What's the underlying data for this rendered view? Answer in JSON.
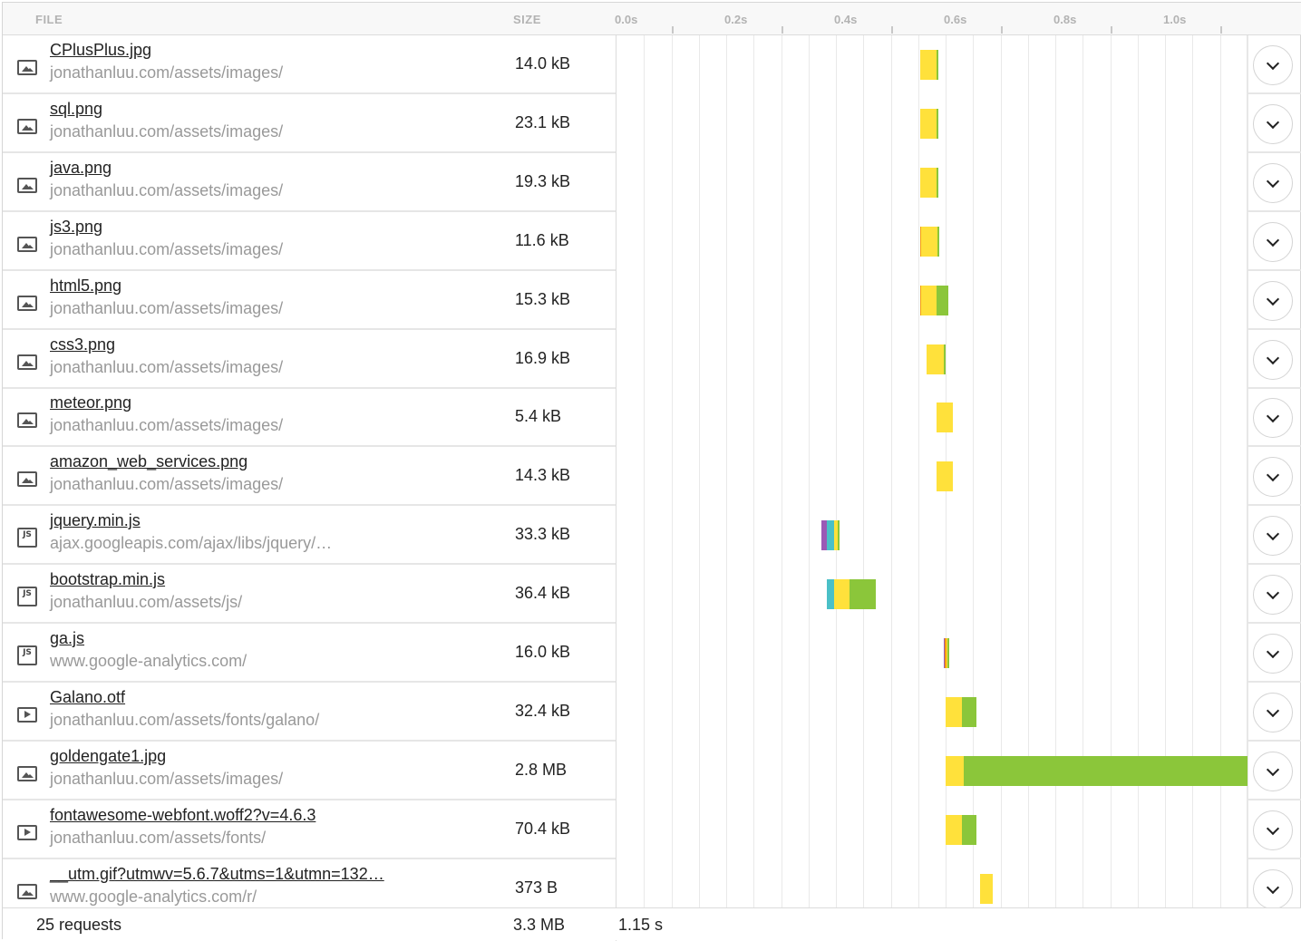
{
  "header": {
    "file_label": "FILE",
    "size_label": "SIZE",
    "ticks": [
      "0.0s",
      "0.2s",
      "0.4s",
      "0.6s",
      "0.8s",
      "1.0s"
    ]
  },
  "colors": {
    "blocked": "#9b59b6",
    "dns": "#4ac0c7",
    "connect": "#f39c12",
    "wait": "#ffe13b",
    "receive": "#8bc63a"
  },
  "rows": [
    {
      "name": "CPlusPlus.jpg",
      "path": "jonathanluu.com/assets/images/",
      "size": "14.0 kB",
      "type": "image-icon",
      "timing": [
        {
          "phase": "wait",
          "start": 0.553,
          "end": 0.584
        },
        {
          "phase": "receive",
          "start": 0.584,
          "end": 0.587
        }
      ]
    },
    {
      "name": "sql.png",
      "path": "jonathanluu.com/assets/images/",
      "size": "23.1 kB",
      "type": "image-icon",
      "timing": [
        {
          "phase": "wait",
          "start": 0.553,
          "end": 0.584
        },
        {
          "phase": "receive",
          "start": 0.584,
          "end": 0.587
        }
      ]
    },
    {
      "name": "java.png",
      "path": "jonathanluu.com/assets/images/",
      "size": "19.3 kB",
      "type": "image-icon",
      "timing": [
        {
          "phase": "wait",
          "start": 0.553,
          "end": 0.584
        },
        {
          "phase": "receive",
          "start": 0.584,
          "end": 0.587
        }
      ]
    },
    {
      "name": "js3.png",
      "path": "jonathanluu.com/assets/images/",
      "size": "11.6 kB",
      "type": "image-icon",
      "timing": [
        {
          "phase": "connect",
          "start": 0.553,
          "end": 0.555
        },
        {
          "phase": "wait",
          "start": 0.555,
          "end": 0.585
        },
        {
          "phase": "receive",
          "start": 0.585,
          "end": 0.588
        }
      ]
    },
    {
      "name": "html5.png",
      "path": "jonathanluu.com/assets/images/",
      "size": "15.3 kB",
      "type": "image-icon",
      "timing": [
        {
          "phase": "connect",
          "start": 0.553,
          "end": 0.555
        },
        {
          "phase": "wait",
          "start": 0.555,
          "end": 0.583
        },
        {
          "phase": "receive",
          "start": 0.583,
          "end": 0.605
        }
      ]
    },
    {
      "name": "css3.png",
      "path": "jonathanluu.com/assets/images/",
      "size": "16.9 kB",
      "type": "image-icon",
      "timing": [
        {
          "phase": "wait",
          "start": 0.566,
          "end": 0.596
        },
        {
          "phase": "receive",
          "start": 0.596,
          "end": 0.599
        }
      ]
    },
    {
      "name": "meteor.png",
      "path": "jonathanluu.com/assets/images/",
      "size": "5.4 kB",
      "type": "image-icon",
      "timing": [
        {
          "phase": "wait",
          "start": 0.583,
          "end": 0.613
        }
      ]
    },
    {
      "name": "amazon_web_services.png",
      "path": "jonathanluu.com/assets/images/",
      "size": "14.3 kB",
      "type": "image-icon",
      "timing": [
        {
          "phase": "wait",
          "start": 0.583,
          "end": 0.613
        }
      ]
    },
    {
      "name": "jquery.min.js",
      "path": "ajax.googleapis.com/ajax/libs/jquery/…",
      "size": "33.3 kB",
      "type": "js-icon",
      "timing": [
        {
          "phase": "blocked",
          "start": 0.373,
          "end": 0.384
        },
        {
          "phase": "dns",
          "start": 0.384,
          "end": 0.396
        },
        {
          "phase": "wait",
          "start": 0.396,
          "end": 0.404
        },
        {
          "phase": "receive",
          "start": 0.404,
          "end": 0.406
        }
      ]
    },
    {
      "name": "bootstrap.min.js",
      "path": "jonathanluu.com/assets/js/",
      "size": "36.4 kB",
      "type": "js-icon",
      "timing": [
        {
          "phase": "dns",
          "start": 0.383,
          "end": 0.396
        },
        {
          "phase": "wait",
          "start": 0.396,
          "end": 0.425
        },
        {
          "phase": "receive",
          "start": 0.425,
          "end": 0.473
        }
      ]
    },
    {
      "name": "ga.js",
      "path": "www.google-analytics.com/",
      "size": "16.0 kB",
      "type": "js-icon",
      "timing": [
        {
          "phase": "blocked",
          "start": 0.596,
          "end": 0.599
        },
        {
          "phase": "connect",
          "start": 0.599,
          "end": 0.601
        },
        {
          "phase": "wait",
          "start": 0.601,
          "end": 0.604
        },
        {
          "phase": "receive",
          "start": 0.604,
          "end": 0.606
        }
      ]
    },
    {
      "name": "Galano.otf",
      "path": "jonathanluu.com/assets/fonts/galano/",
      "size": "32.4 kB",
      "type": "play-icon",
      "timing": [
        {
          "phase": "wait",
          "start": 0.6,
          "end": 0.63
        },
        {
          "phase": "receive",
          "start": 0.63,
          "end": 0.657
        }
      ]
    },
    {
      "name": "goldengate1.jpg",
      "path": "jonathanluu.com/assets/images/",
      "size": "2.8 MB",
      "type": "image-icon",
      "timing": [
        {
          "phase": "wait",
          "start": 0.6,
          "end": 0.633
        },
        {
          "phase": "receive",
          "start": 0.633,
          "end": 1.15
        }
      ]
    },
    {
      "name": "fontawesome-webfont.woff2?v=4.6.3",
      "path": "jonathanluu.com/assets/fonts/",
      "size": "70.4 kB",
      "type": "play-icon",
      "timing": [
        {
          "phase": "wait",
          "start": 0.6,
          "end": 0.63
        },
        {
          "phase": "receive",
          "start": 0.63,
          "end": 0.656
        }
      ]
    },
    {
      "name": "__utm.gif?utmwv=5.6.7&utms=1&utmn=132…",
      "path": "www.google-analytics.com/r/",
      "size": "373 B",
      "type": "image-icon",
      "timing": [
        {
          "phase": "wait",
          "start": 0.663,
          "end": 0.686
        }
      ]
    }
  ],
  "footer": {
    "requests": "25 requests",
    "total_size": "3.3 MB",
    "total_time": "1.15 s"
  }
}
